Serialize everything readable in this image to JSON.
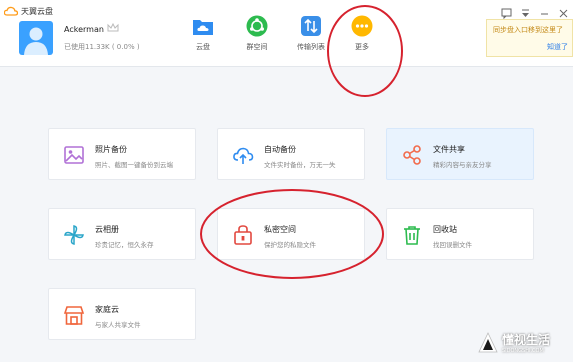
{
  "app": {
    "name": "天翼云盘"
  },
  "user": {
    "name": "Ackerman",
    "usage": "已使用11.33K ( 0.0% )"
  },
  "nav": [
    {
      "label": "云盘",
      "icon": "cloud-folder-icon",
      "color": "#2f8cf0"
    },
    {
      "label": "群空间",
      "icon": "group-space-icon",
      "color": "#2dbb4f"
    },
    {
      "label": "传输列表",
      "icon": "transfer-list-icon",
      "color": "#3a8fe8"
    },
    {
      "label": "更多",
      "icon": "more-icon",
      "color": "#ffb800"
    }
  ],
  "notice": {
    "text": "同步盘入口移到这里了",
    "link": "知道了"
  },
  "cards": [
    {
      "title": "照片备份",
      "desc": "照片、截图一键备份到云端",
      "icon": "photo-icon"
    },
    {
      "title": "自动备份",
      "desc": "文件实时备份，万无一失",
      "icon": "cloud-upload-icon"
    },
    {
      "title": "文件共享",
      "desc": "精彩内容与亲友分享",
      "icon": "share-icon"
    },
    {
      "title": "云相册",
      "desc": "珍贵记忆，恒久永存",
      "icon": "pinwheel-icon"
    },
    {
      "title": "私密空间",
      "desc": "保护您的私隐文件",
      "icon": "lock-icon"
    },
    {
      "title": "回收站",
      "desc": "找回误删文件",
      "icon": "trash-icon"
    },
    {
      "title": "家庭云",
      "desc": "与家人共享文件",
      "icon": "home-cloud-icon"
    }
  ],
  "watermark": {
    "title": "懂视生活",
    "sub": "SIDONGSHI.COM"
  },
  "colors": {
    "accent": "#2f8cf0",
    "annotation": "#d6222e",
    "selected_card": "#e9f3fe"
  }
}
